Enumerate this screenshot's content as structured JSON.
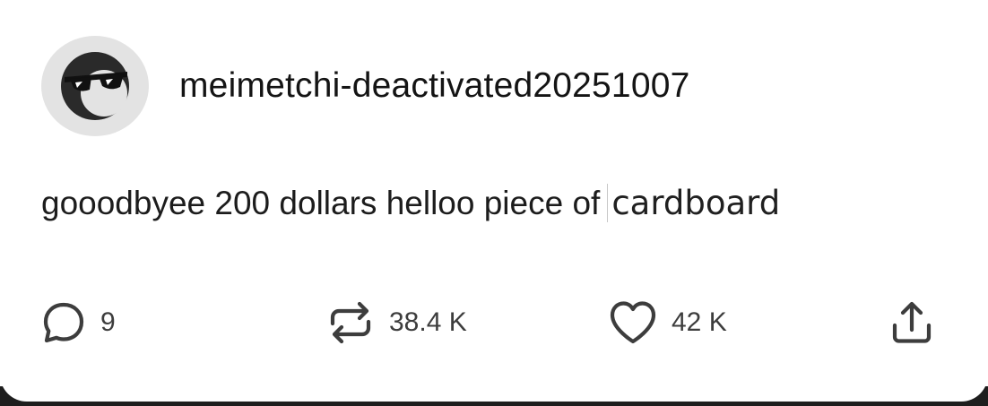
{
  "post": {
    "username": "meimetchi-deactivated20251007",
    "avatar_icon": "sunglasses-avatar-icon",
    "text_main": "gooodbyee 200 dollars helloo piece of",
    "text_tail": "cardboard"
  },
  "actions": {
    "reply": {
      "icon": "comment-icon",
      "count": "9"
    },
    "reblog": {
      "icon": "reblog-icon",
      "count": "38.4 K"
    },
    "like": {
      "icon": "heart-icon",
      "count": "42 K"
    },
    "share": {
      "icon": "share-icon"
    }
  },
  "colors": {
    "text": "#1c1c1c",
    "icon": "#3d3d3d",
    "avatar_bg": "#e3e3e3",
    "frame": "#1e1e1e"
  }
}
